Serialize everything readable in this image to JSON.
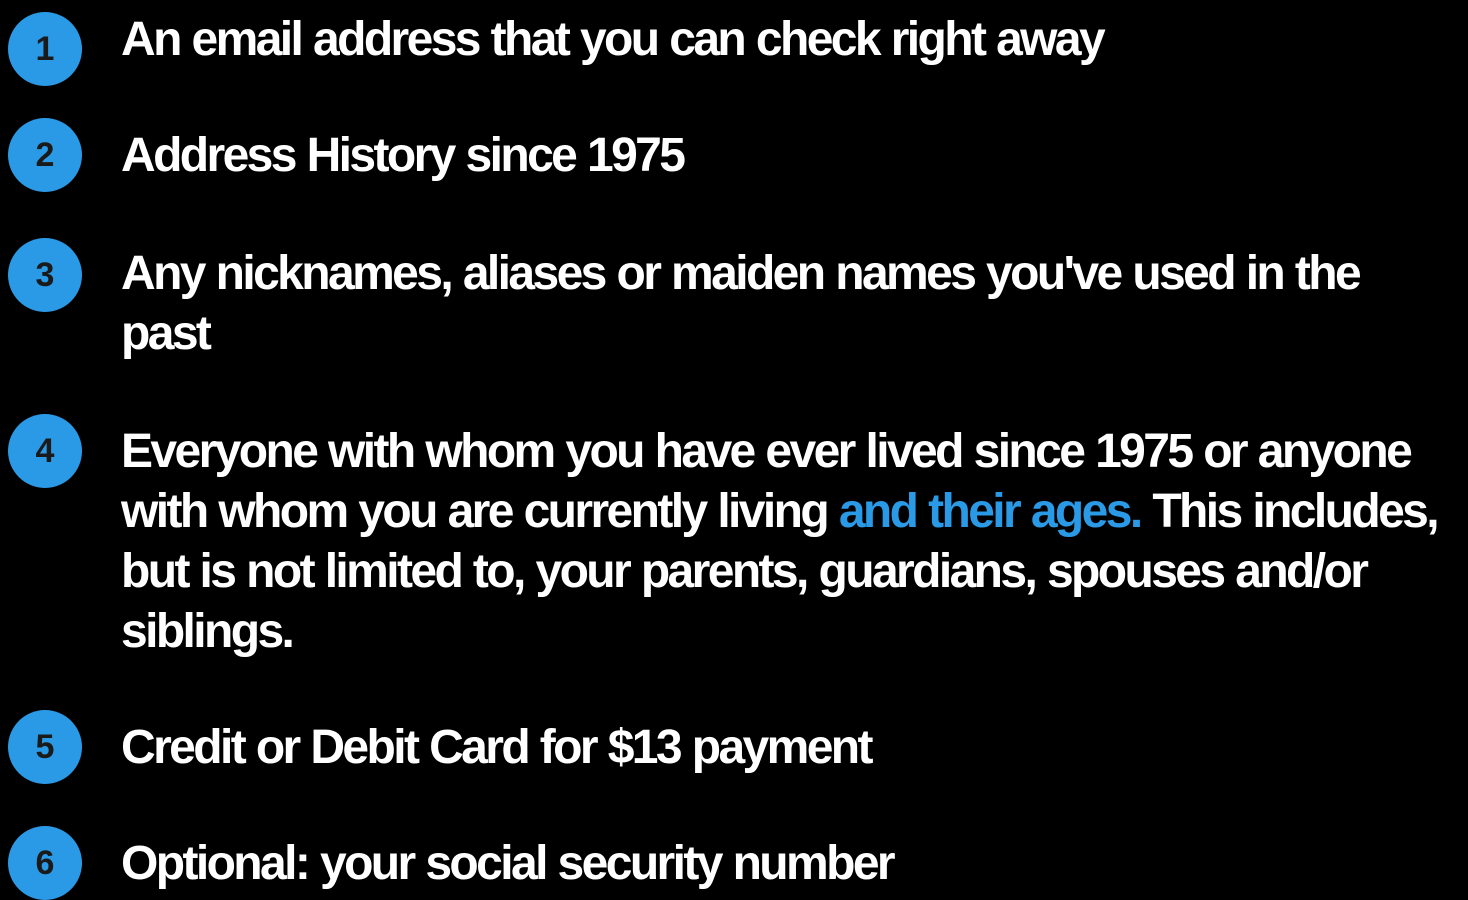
{
  "colors": {
    "background": "#000000",
    "text": "#ffffff",
    "accent": "#2a9ae6",
    "badge_text": "#1a1a1a"
  },
  "items": [
    {
      "number": "1",
      "text": "An email address that you can check right away"
    },
    {
      "number": "2",
      "text": "Address History since 1975"
    },
    {
      "number": "3",
      "text": "Any nicknames, aliases or maiden names you've used in the past"
    },
    {
      "number": "4",
      "text_before": "Everyone with whom you have ever lived since 1975 or anyone with whom you are currently living ",
      "text_highlight": "and their ages.",
      "text_after": " This includes, but is not limited to, your parents, guardians, spouses and/or siblings."
    },
    {
      "number": "5",
      "text": "Credit or Debit Card for $13 payment"
    },
    {
      "number": "6",
      "text": "Optional: your social security number"
    }
  ]
}
